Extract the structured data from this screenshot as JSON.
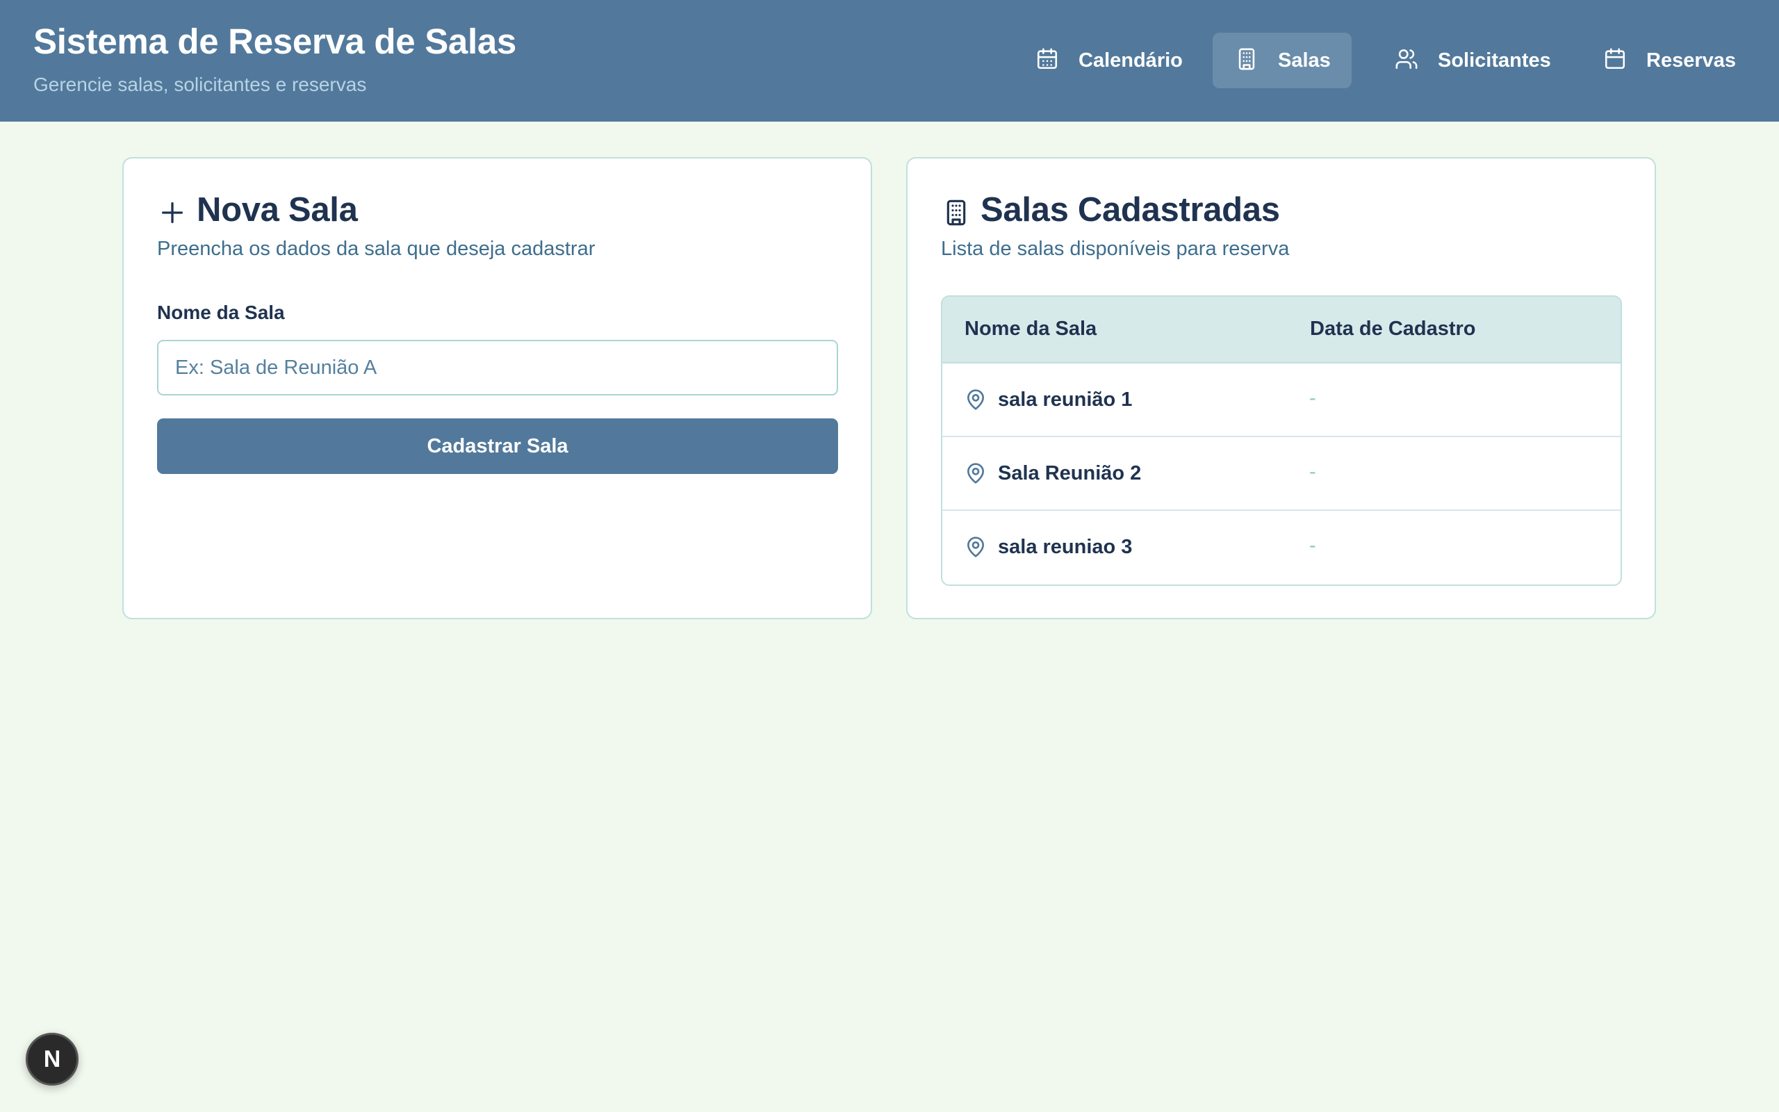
{
  "header": {
    "title": "Sistema de Reserva de Salas",
    "subtitle": "Gerencie salas, solicitantes e reservas",
    "nav": [
      {
        "label": "Calendário",
        "icon": "calendar-icon",
        "active": false
      },
      {
        "label": "Salas",
        "icon": "building-icon",
        "active": true
      },
      {
        "label": "Solicitantes",
        "icon": "users-icon",
        "active": false
      },
      {
        "label": "Reservas",
        "icon": "calendar-icon",
        "active": false
      }
    ]
  },
  "new_room": {
    "title": "Nova Sala",
    "subtitle": "Preencha os dados da sala que deseja cadastrar",
    "field_label": "Nome da Sala",
    "input_value": "",
    "input_placeholder": "Ex: Sala de Reunião A",
    "submit_label": "Cadastrar Sala"
  },
  "rooms": {
    "title": "Salas Cadastradas",
    "subtitle": "Lista de salas disponíveis para reserva",
    "columns": [
      "Nome da Sala",
      "Data de Cadastro"
    ],
    "rows": [
      {
        "name": "sala reunião 1",
        "date": "-"
      },
      {
        "name": "Sala Reunião 2",
        "date": "-"
      },
      {
        "name": "sala reuniao 3",
        "date": "-"
      }
    ]
  },
  "badge": {
    "label": "N"
  },
  "colors": {
    "header_bg": "#52799b",
    "page_bg": "#f1f8ee",
    "accent": "#52799b",
    "card_border": "#bfe0dd",
    "text_dark": "#1f3350",
    "text_muted": "#3d6e8d"
  }
}
